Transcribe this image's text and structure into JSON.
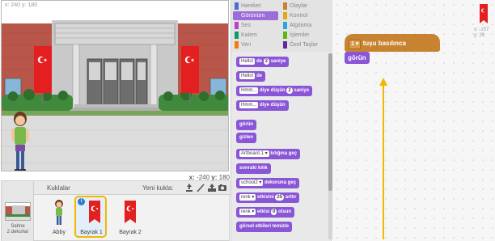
{
  "stage": {
    "corner_coords": "x: 240 y: 180",
    "mouse_x_label": "x:",
    "mouse_x": "-240",
    "mouse_y_label": "y:",
    "mouse_y": "180"
  },
  "sprites_pane": {
    "title": "Kuklalar",
    "new_sprite_label": "Yeni kukla:",
    "stage_item": {
      "name": "Sahne",
      "backdrops": "2 dekorlar"
    },
    "sprites": [
      {
        "name": "Abby",
        "selected": false
      },
      {
        "name": "Bayrak 1",
        "selected": true,
        "info_badge": "i"
      },
      {
        "name": "Bayrak 2",
        "selected": false
      }
    ],
    "tool_icons": [
      "stamp-icon",
      "paint-brush-icon",
      "upload-icon",
      "camera-icon"
    ]
  },
  "palette": {
    "categories": [
      {
        "label": "Hareket",
        "color": "#4a6cd4"
      },
      {
        "label": "Olaylar",
        "color": "#c88330"
      },
      {
        "label": "Görünüm",
        "color": "#8a55d7",
        "active": true
      },
      {
        "label": "Kontrol",
        "color": "#e1a91a"
      },
      {
        "label": "Ses",
        "color": "#bb42c3"
      },
      {
        "label": "Algılama",
        "color": "#2ca5e2"
      },
      {
        "label": "Kalem",
        "color": "#0e9a6c"
      },
      {
        "label": "İşlemler",
        "color": "#5cb712"
      },
      {
        "label": "Veri",
        "color": "#ee7d16"
      },
      {
        "label": "Özel Taşlar",
        "color": "#632d99"
      }
    ],
    "blocks": [
      {
        "pre": "",
        "input": "Hello!",
        "mid": " de ",
        "num": "2",
        "post": " saniye"
      },
      {
        "pre": "",
        "input": "Hello!",
        "mid": " de",
        "num": "",
        "post": ""
      },
      {
        "pre": "",
        "input": "Hmm...",
        "mid": " diye düşün ",
        "num": "2",
        "post": " saniye"
      },
      {
        "pre": "",
        "input": "Hmm...",
        "mid": " diye düşün",
        "num": "",
        "post": ""
      },
      {
        "pre": "görün",
        "input": "",
        "mid": "",
        "num": "",
        "post": ""
      },
      {
        "pre": "gizlen",
        "input": "",
        "mid": "",
        "num": "",
        "post": ""
      },
      {
        "pre": "",
        "input": "Artboard 1 ▾",
        "mid": " kılığına geç",
        "num": "",
        "post": ""
      },
      {
        "pre": "sonraki kılık",
        "input": "",
        "mid": "",
        "num": "",
        "post": ""
      },
      {
        "pre": "",
        "input": "school2 ▾",
        "mid": " dekoruna geç",
        "num": "",
        "post": ""
      },
      {
        "pre": "",
        "input": "renk ▾",
        "mid": " etkisini ",
        "num": "25",
        "post": " arttır"
      },
      {
        "pre": "",
        "input": "renk ▾",
        "mid": " etkisi ",
        "num": "0",
        "post": " olsun"
      },
      {
        "pre": "görsel etkileri temizle",
        "input": "",
        "mid": "",
        "num": "",
        "post": ""
      }
    ]
  },
  "scripts": {
    "hat_key": "1 ▾",
    "hat_text": " tuşu basılınca",
    "show_block": "görün",
    "sprite_x": "x: -157",
    "sprite_y": "y: 29",
    "colors": {
      "events": "#c88330",
      "looks": "#8a55d7",
      "arrow": "#f2b800"
    }
  }
}
